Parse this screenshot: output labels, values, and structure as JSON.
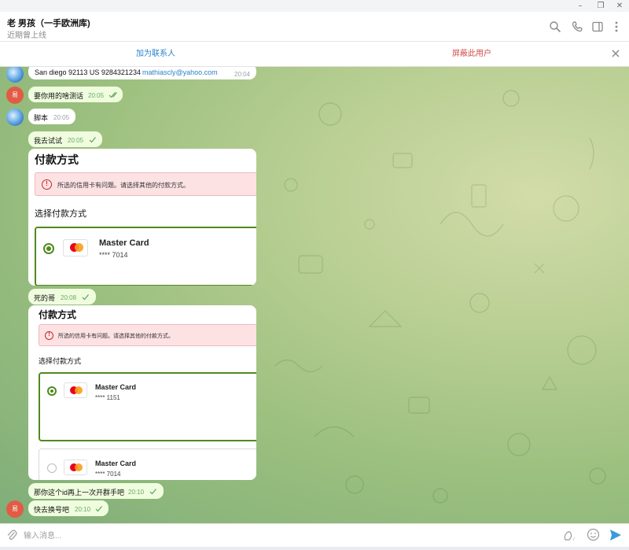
{
  "window": {
    "minimize_glyph": "–",
    "restore_glyph": "❐",
    "close_glyph": "✕"
  },
  "chat": {
    "name": "老 男孩（一手欧洲库)",
    "status": "近期曾上线"
  },
  "header_icons": [
    "search-icon",
    "phone-icon",
    "sidebar-toggle-icon",
    "more-vertical-icon"
  ],
  "action_bar": {
    "add_contact": "加为联系人",
    "block_user": "屏蔽此用户"
  },
  "messages": [
    {
      "from": "them",
      "text": "San diego  92113  US  9284321234",
      "link": "mathiascly@yahoo.com",
      "time": "20:04"
    },
    {
      "from": "me_avatar",
      "text": "要你用的啥测话",
      "time": "20:05"
    },
    {
      "from": "them",
      "text": "脚本",
      "time": "20:05"
    },
    {
      "from": "me",
      "text": "我去试试",
      "time": "20:05"
    },
    {
      "from": "me",
      "text": "死的哥",
      "time": "20:08"
    },
    {
      "from": "me",
      "text": "那你这个id再上一次开群手吧",
      "time": "20:10"
    },
    {
      "from": "me_avatar",
      "text": "快去换号吧",
      "time": "20:10"
    }
  ],
  "avatars": {
    "me_initial": "易"
  },
  "screenshot1": {
    "title": "付款方式",
    "alert": "所选的信用卡有问题。请选择其他的付款方式。",
    "select_title": "选择付款方式",
    "cards": [
      {
        "name": "Master Card",
        "number": "**** 7014",
        "selected": true
      }
    ]
  },
  "screenshot2": {
    "title": "付款方式",
    "alert": "所选的信用卡有问题。请选择其他的付款方式。",
    "select_title": "选择付款方式",
    "cards": [
      {
        "name": "Master Card",
        "number": "**** 1151",
        "selected": true
      },
      {
        "name": "Master Card",
        "number": "**** 7014",
        "selected": false
      }
    ]
  },
  "composer": {
    "placeholder": "输入消息..."
  },
  "colors": {
    "accent": "#2b83c8",
    "danger": "#d14b4b",
    "outgoing_bubble": "#effdde",
    "card_border": "#4f8a1e"
  }
}
